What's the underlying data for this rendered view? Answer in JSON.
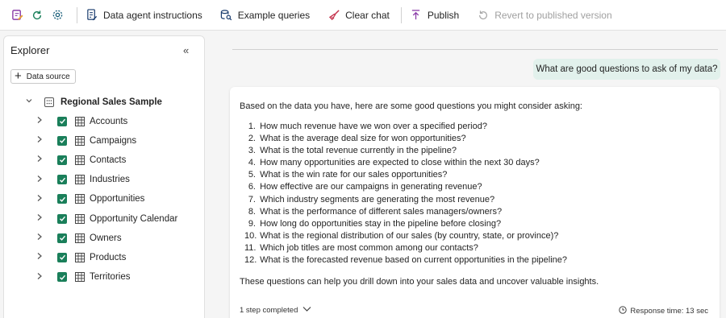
{
  "toolbar": {
    "data_agent_instructions": "Data agent instructions",
    "example_queries": "Example queries",
    "clear_chat": "Clear chat",
    "publish": "Publish",
    "revert": "Revert to published version"
  },
  "explorer": {
    "title": "Explorer",
    "data_source_button": "Data source",
    "root": "Regional Sales Sample",
    "tables": [
      "Accounts",
      "Campaigns",
      "Contacts",
      "Industries",
      "Opportunities",
      "Opportunity Calendar",
      "Owners",
      "Products",
      "Territories"
    ]
  },
  "chat": {
    "user_message": "What are good questions to ask of my data?",
    "intro": "Based on the data you have, here are some good questions you might consider asking:",
    "questions": [
      "How much revenue have we won over a specified period?",
      "What is the average deal size for won opportunities?",
      "What is the total revenue currently in the pipeline?",
      "How many opportunities are expected to close within the next 30 days?",
      "What is the win rate for our sales opportunities?",
      "How effective are our campaigns in generating revenue?",
      "Which industry segments are generating the most revenue?",
      "What is the performance of different sales managers/owners?",
      "How long do opportunities stay in the pipeline before closing?",
      "What is the regional distribution of our sales (by country, state, or province)?",
      "Which job titles are most common among our contacts?",
      "What is the forecasted revenue based on current opportunities in the pipeline?"
    ],
    "outro": "These questions can help you drill down into your sales data and uncover valuable insights.",
    "steps": "1 step completed",
    "response_time": "Response time: 13 sec"
  },
  "colors": {
    "accent": "#1a7f5a",
    "bubble": "#e2f1ec",
    "clear_chat_icon": "#c4314b"
  }
}
